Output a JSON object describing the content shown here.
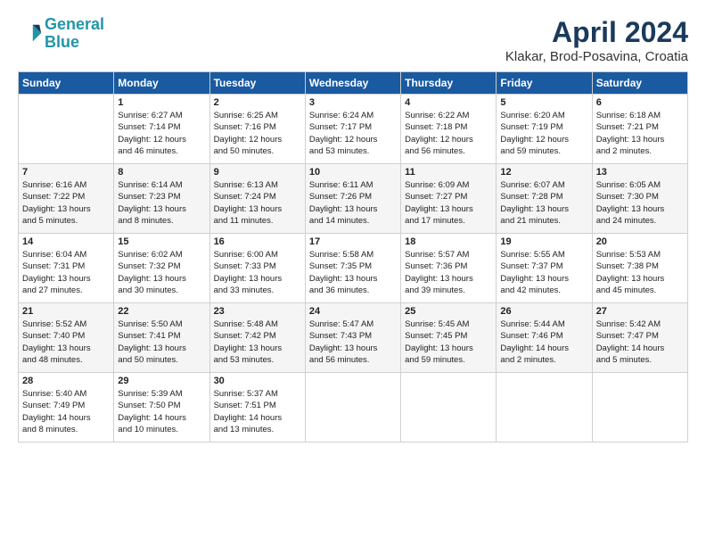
{
  "header": {
    "logo_line1": "General",
    "logo_line2": "Blue",
    "month_title": "April 2024",
    "location": "Klakar, Brod-Posavina, Croatia"
  },
  "weekdays": [
    "Sunday",
    "Monday",
    "Tuesday",
    "Wednesday",
    "Thursday",
    "Friday",
    "Saturday"
  ],
  "weeks": [
    [
      {
        "day": "",
        "content": ""
      },
      {
        "day": "1",
        "content": "Sunrise: 6:27 AM\nSunset: 7:14 PM\nDaylight: 12 hours\nand 46 minutes."
      },
      {
        "day": "2",
        "content": "Sunrise: 6:25 AM\nSunset: 7:16 PM\nDaylight: 12 hours\nand 50 minutes."
      },
      {
        "day": "3",
        "content": "Sunrise: 6:24 AM\nSunset: 7:17 PM\nDaylight: 12 hours\nand 53 minutes."
      },
      {
        "day": "4",
        "content": "Sunrise: 6:22 AM\nSunset: 7:18 PM\nDaylight: 12 hours\nand 56 minutes."
      },
      {
        "day": "5",
        "content": "Sunrise: 6:20 AM\nSunset: 7:19 PM\nDaylight: 12 hours\nand 59 minutes."
      },
      {
        "day": "6",
        "content": "Sunrise: 6:18 AM\nSunset: 7:21 PM\nDaylight: 13 hours\nand 2 minutes."
      }
    ],
    [
      {
        "day": "7",
        "content": "Sunrise: 6:16 AM\nSunset: 7:22 PM\nDaylight: 13 hours\nand 5 minutes."
      },
      {
        "day": "8",
        "content": "Sunrise: 6:14 AM\nSunset: 7:23 PM\nDaylight: 13 hours\nand 8 minutes."
      },
      {
        "day": "9",
        "content": "Sunrise: 6:13 AM\nSunset: 7:24 PM\nDaylight: 13 hours\nand 11 minutes."
      },
      {
        "day": "10",
        "content": "Sunrise: 6:11 AM\nSunset: 7:26 PM\nDaylight: 13 hours\nand 14 minutes."
      },
      {
        "day": "11",
        "content": "Sunrise: 6:09 AM\nSunset: 7:27 PM\nDaylight: 13 hours\nand 17 minutes."
      },
      {
        "day": "12",
        "content": "Sunrise: 6:07 AM\nSunset: 7:28 PM\nDaylight: 13 hours\nand 21 minutes."
      },
      {
        "day": "13",
        "content": "Sunrise: 6:05 AM\nSunset: 7:30 PM\nDaylight: 13 hours\nand 24 minutes."
      }
    ],
    [
      {
        "day": "14",
        "content": "Sunrise: 6:04 AM\nSunset: 7:31 PM\nDaylight: 13 hours\nand 27 minutes."
      },
      {
        "day": "15",
        "content": "Sunrise: 6:02 AM\nSunset: 7:32 PM\nDaylight: 13 hours\nand 30 minutes."
      },
      {
        "day": "16",
        "content": "Sunrise: 6:00 AM\nSunset: 7:33 PM\nDaylight: 13 hours\nand 33 minutes."
      },
      {
        "day": "17",
        "content": "Sunrise: 5:58 AM\nSunset: 7:35 PM\nDaylight: 13 hours\nand 36 minutes."
      },
      {
        "day": "18",
        "content": "Sunrise: 5:57 AM\nSunset: 7:36 PM\nDaylight: 13 hours\nand 39 minutes."
      },
      {
        "day": "19",
        "content": "Sunrise: 5:55 AM\nSunset: 7:37 PM\nDaylight: 13 hours\nand 42 minutes."
      },
      {
        "day": "20",
        "content": "Sunrise: 5:53 AM\nSunset: 7:38 PM\nDaylight: 13 hours\nand 45 minutes."
      }
    ],
    [
      {
        "day": "21",
        "content": "Sunrise: 5:52 AM\nSunset: 7:40 PM\nDaylight: 13 hours\nand 48 minutes."
      },
      {
        "day": "22",
        "content": "Sunrise: 5:50 AM\nSunset: 7:41 PM\nDaylight: 13 hours\nand 50 minutes."
      },
      {
        "day": "23",
        "content": "Sunrise: 5:48 AM\nSunset: 7:42 PM\nDaylight: 13 hours\nand 53 minutes."
      },
      {
        "day": "24",
        "content": "Sunrise: 5:47 AM\nSunset: 7:43 PM\nDaylight: 13 hours\nand 56 minutes."
      },
      {
        "day": "25",
        "content": "Sunrise: 5:45 AM\nSunset: 7:45 PM\nDaylight: 13 hours\nand 59 minutes."
      },
      {
        "day": "26",
        "content": "Sunrise: 5:44 AM\nSunset: 7:46 PM\nDaylight: 14 hours\nand 2 minutes."
      },
      {
        "day": "27",
        "content": "Sunrise: 5:42 AM\nSunset: 7:47 PM\nDaylight: 14 hours\nand 5 minutes."
      }
    ],
    [
      {
        "day": "28",
        "content": "Sunrise: 5:40 AM\nSunset: 7:49 PM\nDaylight: 14 hours\nand 8 minutes."
      },
      {
        "day": "29",
        "content": "Sunrise: 5:39 AM\nSunset: 7:50 PM\nDaylight: 14 hours\nand 10 minutes."
      },
      {
        "day": "30",
        "content": "Sunrise: 5:37 AM\nSunset: 7:51 PM\nDaylight: 14 hours\nand 13 minutes."
      },
      {
        "day": "",
        "content": ""
      },
      {
        "day": "",
        "content": ""
      },
      {
        "day": "",
        "content": ""
      },
      {
        "day": "",
        "content": ""
      }
    ]
  ]
}
